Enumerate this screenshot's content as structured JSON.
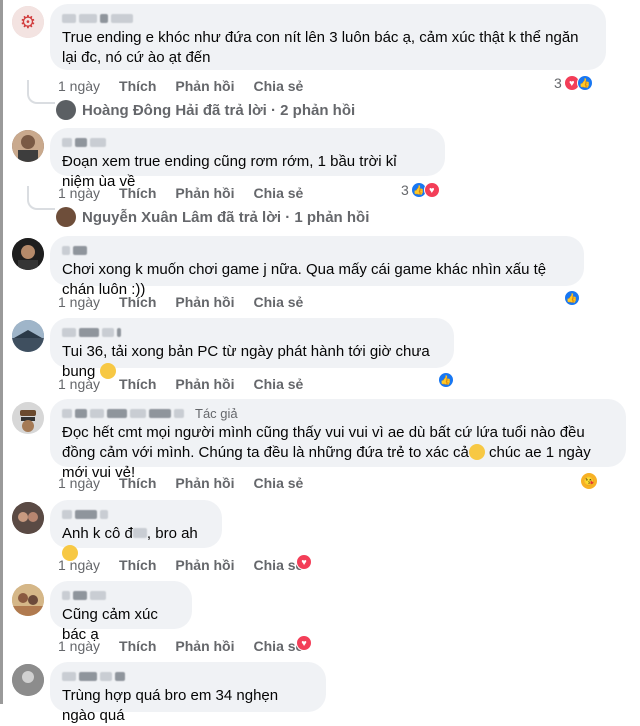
{
  "actions": {
    "time": "1 ngày",
    "like": "Thích",
    "reply": "Phản hồi",
    "share": "Chia sẻ"
  },
  "comments": [
    {
      "text": "True ending e khóc như đứa con nít lên 3 luôn bác ạ, cảm xúc thật k thể ngăn lại đc, nó cứ ào ạt đến",
      "reaction_count": "3"
    },
    {
      "text": "Đoạn xem true ending cũng rơm rớm, 1 bầu trời kỉ niệm ùa về",
      "reaction_count": "3"
    },
    {
      "text": "Chơi xong k muốn chơi game j nữa. Qua mấy cái game khác nhìn xấu tệ chán luôn :))"
    },
    {
      "text": "Tui 36, tải xong bản PC từ ngày phát hành tới giờ chưa bung"
    },
    {
      "author_tag": "Tác giả",
      "text": "Đọc hết cmt mọi người mình cũng thấy vui vui vì ae dù bất cứ lứa tuổi nào đều đồng cảm với mình. Chúng ta đều là những đứa trẻ to xác cả",
      "text_tail": " chúc ae 1 ngày mới vui vẻ!"
    },
    {
      "text": "Anh k cô đ",
      "text_tail": ", bro ah"
    },
    {
      "text": "Cũng cảm xúc bác ạ"
    },
    {
      "text": "Trùng hợp quá bro em 34 nghẹn ngào quá"
    }
  ],
  "replies": [
    {
      "text": "Hoàng Đông Hải đã trả lời · 2 phản hồi"
    },
    {
      "text": "Nguyễn Xuân Lâm đã trả lời · 1 phản hồi"
    }
  ],
  "colors": {
    "bubble": "#f0f2f5",
    "meta": "#65676b",
    "like": "#1877f2",
    "love": "#f33e58"
  }
}
